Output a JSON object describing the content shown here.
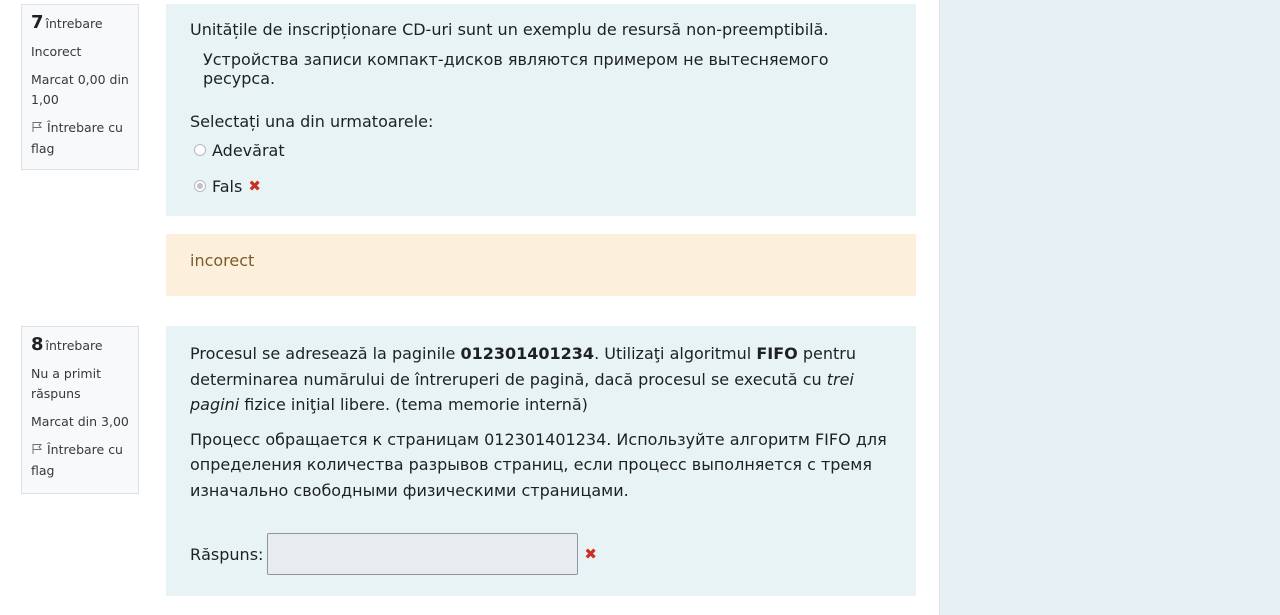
{
  "q7": {
    "number": "7",
    "question_word": "întrebare",
    "state": "Incorect",
    "grade": "Marcat 0,00 din 1,00",
    "flag_label": "Întrebare cu flag",
    "text_ro": "Unitățile de inscripționare CD-uri sunt un exemplu de resursă non-preemptibilă.",
    "text_ru": "Устройства записи компакт-дисков являются примером не вытесняемого ресурса.",
    "prompt": "Selectați una din urmatoarele:",
    "options": [
      {
        "label": "Adevărat",
        "checked": false
      },
      {
        "label": "Fals",
        "checked": true,
        "mark": "✖"
      }
    ],
    "feedback": "incorect"
  },
  "q8": {
    "number": "8",
    "question_word": "întrebare",
    "state": "Nu a primit răspuns",
    "grade": "Marcat din 3,00",
    "flag_label": "Întrebare cu flag",
    "text_ro_1": "Procesul se adresează la paginile ",
    "text_ro_pages": "012301401234",
    "text_ro_2": ". Utilizaţi algoritmul ",
    "text_ro_algo": "FIFO",
    "text_ro_3": " pentru determinarea numărului de întreruperi de pagină, dacă procesul se execută cu ",
    "text_ro_em": "trei pagini",
    "text_ro_4": " fizice iniţial libere. (tema memorie internă)",
    "text_ru": "Процесс обращается к страницам 012301401234. Используйте алгоритм FIFO для определения количества разрывов страниц, если процесс выполняется с тремя изначально свободными физическими страницами.",
    "answer_label": "Răspuns:",
    "answer_value": "",
    "mark": "✖"
  }
}
